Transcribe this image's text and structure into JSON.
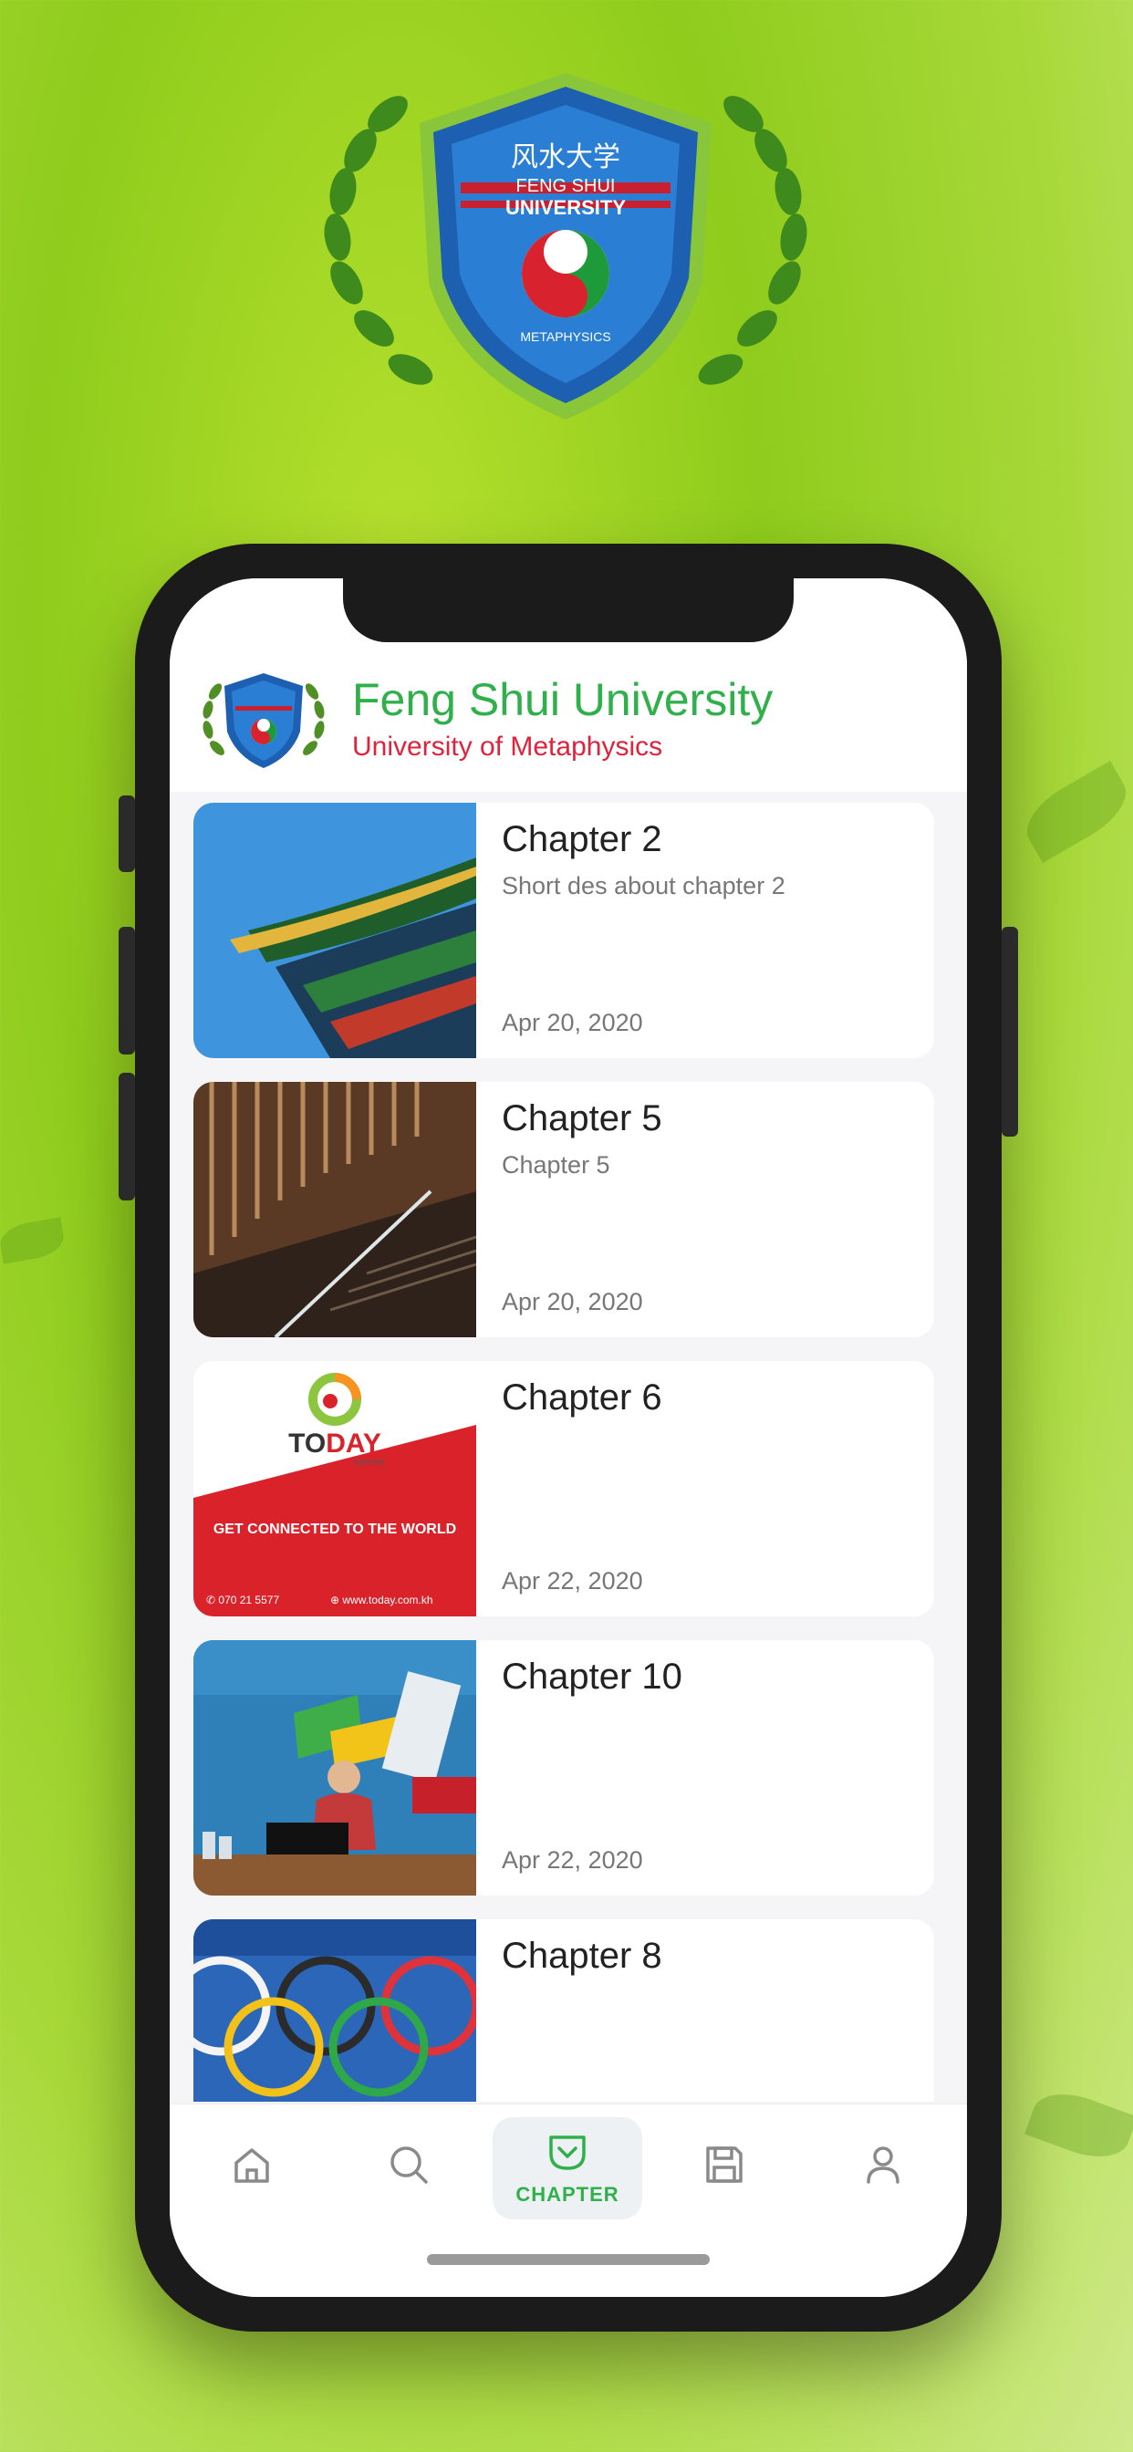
{
  "emblem": {
    "chinese_text": "风水大学",
    "line1": "FENG SHUI",
    "line2": "UNIVERSITY",
    "line3": "METAPHYSICS"
  },
  "header": {
    "title": "Feng Shui University",
    "subtitle": "University of Metaphysics"
  },
  "chapters": [
    {
      "title": "Chapter 2",
      "description": "Short des about chapter 2",
      "date": "Apr 20, 2020",
      "image": "pagoda-roof-image"
    },
    {
      "title": "Chapter 5",
      "description": "Chapter 5",
      "date": "Apr 20, 2020",
      "image": "staircase-image"
    },
    {
      "title": "Chapter 6",
      "description": "",
      "date": "Apr 22, 2020",
      "image": "today-internet-ad-image",
      "ad": {
        "brand_pre": "TO",
        "brand_post": "DAY",
        "brand_sub": "internet",
        "tagline": "GET CONNECTED TO THE WORLD",
        "phone": "070 21 5577",
        "website": "www.today.com.kh"
      }
    },
    {
      "title": "Chapter 10",
      "description": "",
      "date": "Apr 22, 2020",
      "image": "booth-photo-image"
    },
    {
      "title": "Chapter 8",
      "description": "",
      "date": "",
      "image": "olympic-rings-image"
    }
  ],
  "nav": {
    "items": [
      {
        "icon": "home-icon",
        "label": ""
      },
      {
        "icon": "search-icon",
        "label": ""
      },
      {
        "icon": "chapter-icon",
        "label": "CHAPTER"
      },
      {
        "icon": "save-icon",
        "label": ""
      },
      {
        "icon": "profile-icon",
        "label": ""
      }
    ],
    "active_index": 2
  },
  "colors": {
    "title_green": "#2fb04a",
    "subtitle_red": "#e0223a",
    "nav_active": "#2fb04a",
    "nav_inactive": "#8a8a8a"
  }
}
